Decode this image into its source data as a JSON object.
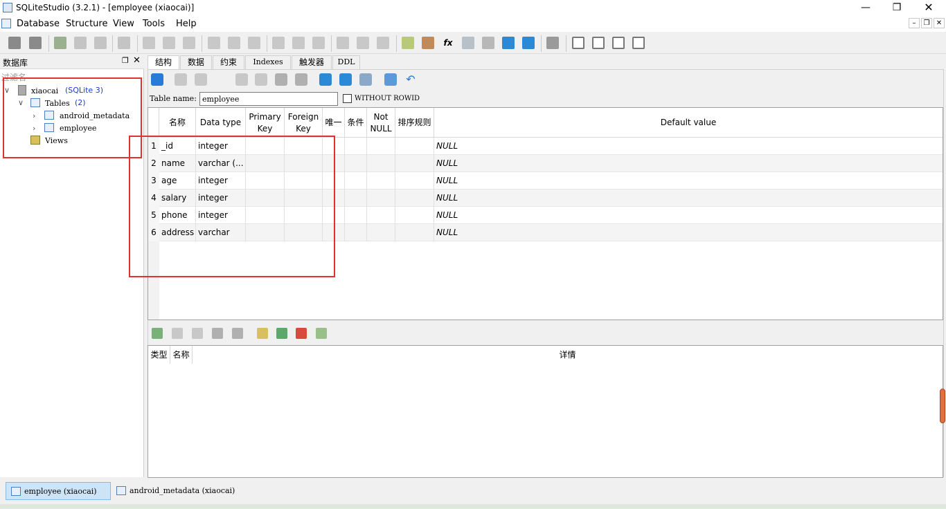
{
  "window": {
    "title": "SQLiteStudio (3.2.1) - [employee (xiaocai)]"
  },
  "menu": [
    "Database",
    "Structure",
    "View",
    "Tools",
    "Help"
  ],
  "dbpanel": {
    "title": "数据库",
    "filter_placeholder": "过滤名",
    "db_name": "xiaocai",
    "db_type": "(SQLite 3)",
    "tables_label": "Tables",
    "tables_count": "(2)",
    "tables": [
      "android_metadata",
      "employee"
    ],
    "views_label": "Views"
  },
  "tabs": [
    "结构",
    "数据",
    "约束",
    "Indexes",
    "触发器",
    "DDL"
  ],
  "table_name_label": "Table name:",
  "table_name": "employee",
  "without_rowid_label": "WITHOUT ROWID",
  "columns_header": [
    "名称",
    "Data type",
    "Primary Key",
    "Foreign Key",
    "唯一",
    "条件",
    "Not NULL",
    "排序规则",
    "Default value"
  ],
  "columns": [
    {
      "n": "1",
      "name": "_id",
      "type": "integer",
      "default": "NULL"
    },
    {
      "n": "2",
      "name": "name",
      "type": "varchar (...",
      "default": "NULL"
    },
    {
      "n": "3",
      "name": "age",
      "type": "integer",
      "default": "NULL"
    },
    {
      "n": "4",
      "name": "salary",
      "type": "integer",
      "default": "NULL"
    },
    {
      "n": "5",
      "name": "phone",
      "type": "integer",
      "default": "NULL"
    },
    {
      "n": "6",
      "name": "address",
      "type": "varchar",
      "default": "NULL"
    }
  ],
  "constraints_header": [
    "类型",
    "名称",
    "详情"
  ],
  "window_tabs": [
    "employee (xiaocai)",
    "android_metadata (xiaocai)"
  ],
  "colors": {
    "highlight": "#e03030",
    "link": "#1a3ad0",
    "active_tab": "#cde4f7"
  }
}
